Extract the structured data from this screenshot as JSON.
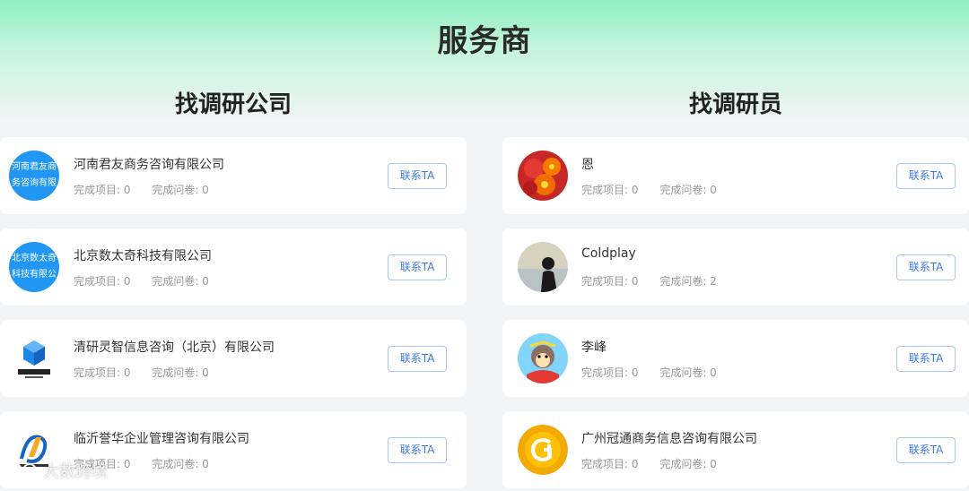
{
  "header": {
    "title": "服务商"
  },
  "companies": {
    "title": "找调研公司",
    "items": [
      {
        "name": "河南君友商务咨询有限公司",
        "projects": "完成项目: 0",
        "surveys": "完成问卷: 0",
        "contact": "联系TA",
        "avatar_text": [
          "河南君友商",
          "务咨询有限"
        ]
      },
      {
        "name": "北京数太奇科技有限公司",
        "projects": "完成项目: 0",
        "surveys": "完成问卷: 0",
        "contact": "联系TA",
        "avatar_text": [
          "北京数太奇",
          "科技有限公"
        ]
      },
      {
        "name": "清研灵智信息咨询（北京）有限公司",
        "projects": "完成项目: 0",
        "surveys": "完成问卷: 0",
        "contact": "联系TA"
      },
      {
        "name": "临沂誉华企业管理咨询有限公司",
        "projects": "完成项目: 0",
        "surveys": "完成问卷: 0",
        "contact": "联系TA"
      }
    ]
  },
  "researchers": {
    "title": "找调研员",
    "items": [
      {
        "name": "恩",
        "projects": "完成项目: 0",
        "surveys": "完成问卷: 0",
        "contact": "联系TA"
      },
      {
        "name": "Coldplay",
        "projects": "完成项目: 0",
        "surveys": "完成问卷: 2",
        "contact": "联系TA"
      },
      {
        "name": "李峰",
        "projects": "完成项目: 0",
        "surveys": "完成问卷: 0",
        "contact": "联系TA"
      },
      {
        "name": "广州冠通商务信息咨询有限公司",
        "projects": "完成项目: 0",
        "surveys": "完成问卷: 0",
        "contact": "联系TA"
      }
    ]
  },
  "watermark": {
    "text": "大数跨境"
  },
  "colors": {
    "accent": "#3a7be0",
    "header_gradient_top": "#8ff0c0",
    "avatar_blue": "#2196f3"
  }
}
